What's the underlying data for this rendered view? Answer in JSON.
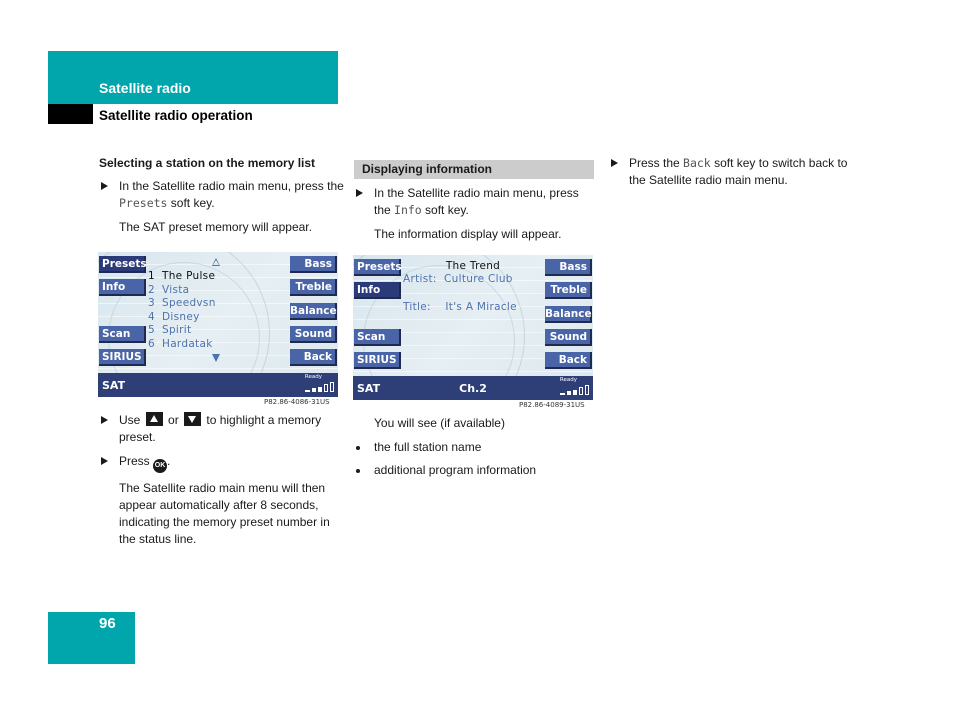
{
  "header": {
    "section_title": "Satellite radio",
    "subsection_title": "Satellite radio operation"
  },
  "page_number": "96",
  "column1": {
    "heading": "Selecting a station on the memory list",
    "step1_pre": "In the Satellite radio main menu, press the ",
    "step1_key": "Presets",
    "step1_post": " soft key.",
    "result1": "The SAT preset memory will appear.",
    "step2_pre": "Use ",
    "step2_mid": " or ",
    "step2_post": " to highlight a memory preset.",
    "step3_pre": "Press ",
    "step3_post": ".",
    "ok_icon_label": "OK",
    "result3": "The Satellite radio main menu will then appear automatically after 8 seconds, indicating the memory preset number in the status line."
  },
  "screen1": {
    "left_keys": [
      "Presets",
      "Info",
      "Scan",
      "SIRIUS"
    ],
    "right_keys": [
      "Bass",
      "Treble",
      "Balance",
      "Sound",
      "Back"
    ],
    "presets": [
      {
        "num": "1",
        "name": "The Pulse",
        "selected": true
      },
      {
        "num": "2",
        "name": "Vista",
        "selected": false
      },
      {
        "num": "3",
        "name": "Speedvsn",
        "selected": false
      },
      {
        "num": "4",
        "name": "Disney",
        "selected": false
      },
      {
        "num": "5",
        "name": "Spirit",
        "selected": false
      },
      {
        "num": "6",
        "name": "Hardatak",
        "selected": false
      }
    ],
    "status_label": "SAT",
    "ready_label": "Ready",
    "figure_code": "P82.86-4086-31US"
  },
  "column2": {
    "heading": "Displaying information",
    "step1_pre": "In the Satellite radio main menu, press the ",
    "step1_key": "Info",
    "step1_post": " soft key.",
    "result1": "The information display will appear.",
    "you_will_see": "You will see (if available)",
    "bullets": [
      "the full station name",
      "additional program information"
    ]
  },
  "screen2": {
    "left_keys": [
      "Presets",
      "Info",
      "Scan",
      "SIRIUS"
    ],
    "right_keys": [
      "Bass",
      "Treble",
      "Balance",
      "Sound",
      "Back"
    ],
    "station_name": "The Trend",
    "artist_label": "Artist:",
    "artist_value": "Culture Club",
    "title_label": "Title:",
    "title_value": "It's A Miracle",
    "status_label": "SAT",
    "channel": "Ch.2",
    "ready_label": "Ready",
    "figure_code": "P82.86-4089-31US"
  },
  "column3": {
    "step1_pre": "Press the ",
    "step1_key": "Back",
    "step1_post": " soft key to switch back to the Satellite radio main menu."
  },
  "colors": {
    "teal": "#00a6ac",
    "softkey_blue": "#4a64a8",
    "status_bar": "#2e3f78",
    "list_text": "#4d72ad"
  }
}
